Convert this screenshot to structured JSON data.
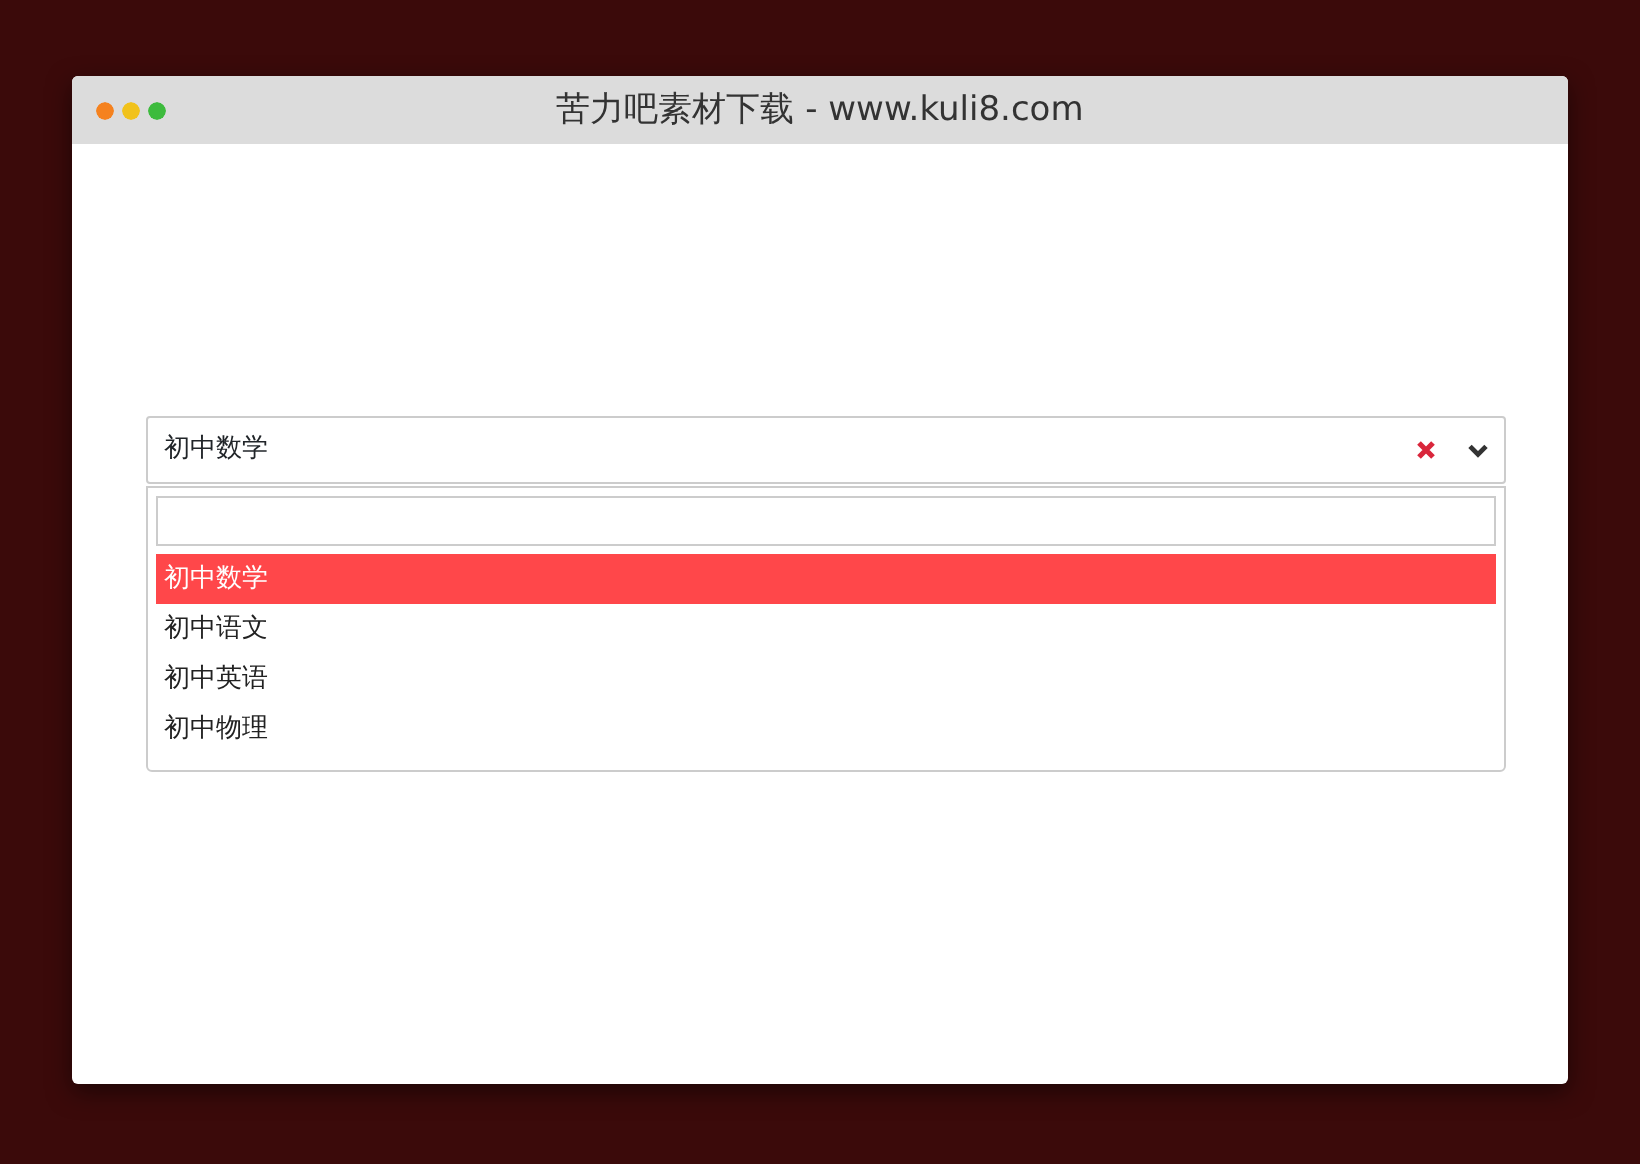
{
  "window": {
    "title": "苦力吧素材下载 - www.kuli8.com"
  },
  "select": {
    "value": "初中数学",
    "expanded": true
  },
  "options": [
    {
      "label": "初中数学",
      "selected": true
    },
    {
      "label": "初中语文",
      "selected": false
    },
    {
      "label": "初中英语",
      "selected": false
    },
    {
      "label": "初中物理",
      "selected": false
    }
  ]
}
